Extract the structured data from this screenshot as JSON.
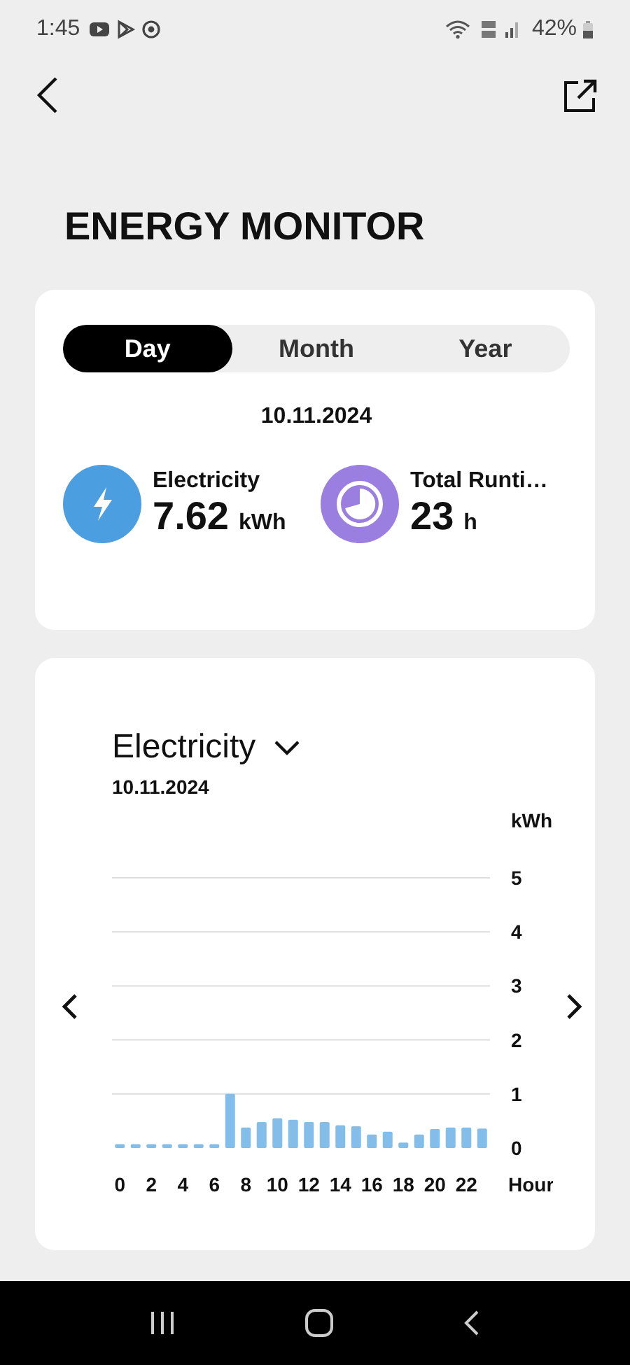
{
  "status_bar": {
    "time": "1:45",
    "battery": "42%"
  },
  "title": "ENERGY MONITOR",
  "tabs": [
    {
      "label": "Day",
      "selected": true
    },
    {
      "label": "Month",
      "selected": false
    },
    {
      "label": "Year",
      "selected": false
    }
  ],
  "date": "10.11.2024",
  "stats": [
    {
      "kind": "electricity",
      "label": "Electricity",
      "value": "7.62",
      "unit": "kWh"
    },
    {
      "kind": "runtime",
      "label": "Total Runti…",
      "value": "23",
      "unit": "h"
    }
  ],
  "chart_card": {
    "metric": "Electricity",
    "date": "10.11.2024",
    "chart_data": {
      "type": "bar",
      "ylabel": "kWh",
      "xlabel": "Hour",
      "x": [
        0,
        1,
        2,
        3,
        4,
        5,
        6,
        7,
        8,
        9,
        10,
        11,
        12,
        13,
        14,
        15,
        16,
        17,
        18,
        19,
        20,
        21,
        22,
        23
      ],
      "values": [
        0.07,
        0.07,
        0.07,
        0.07,
        0.07,
        0.07,
        0.07,
        1.0,
        0.38,
        0.48,
        0.55,
        0.52,
        0.48,
        0.48,
        0.42,
        0.4,
        0.25,
        0.3,
        0.1,
        0.25,
        0.35,
        0.38,
        0.38,
        0.36
      ],
      "xlim": [
        -0.5,
        23.5
      ],
      "ylim": [
        0,
        5
      ],
      "yticks": [
        0,
        1,
        2,
        3,
        4,
        5
      ],
      "xticks": [
        0,
        2,
        4,
        6,
        8,
        10,
        12,
        14,
        16,
        18,
        20,
        22
      ],
      "grid": true
    }
  }
}
